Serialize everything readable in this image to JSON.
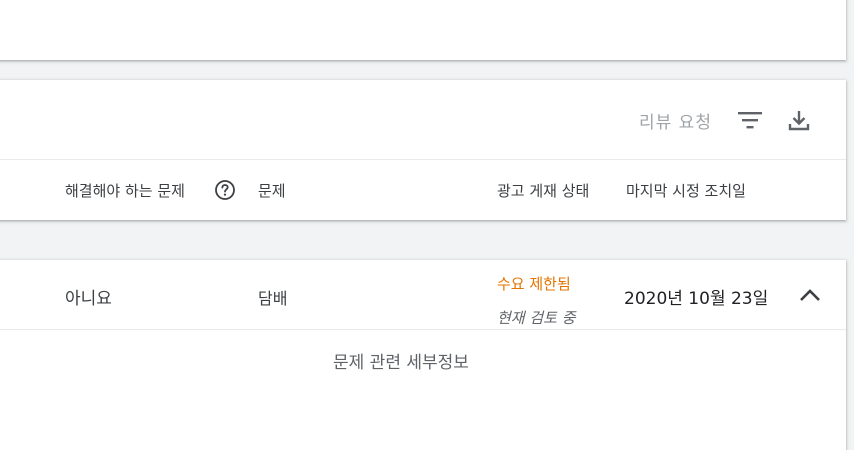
{
  "toolbar": {
    "review_label": "리뷰 요청",
    "filter_icon": "filter-icon",
    "download_icon": "download-icon"
  },
  "table": {
    "headers": {
      "issue": "해결해야 하는 문제",
      "problem": "문제",
      "ad_status": "광고 게재 상태",
      "last_action": "마지막 시정 조치일"
    },
    "help_icon": "help-circle-icon",
    "rows": [
      {
        "issue": "아니요",
        "problem": "담배",
        "status": "수요 제한됨",
        "status_sub": "현재 검토 중",
        "last_action": "2020년 10월 23일",
        "expand_icon": "chevron-up-icon"
      }
    ],
    "details_label": "문제 관련 세부정보"
  },
  "colors": {
    "status_limited": "#e37400",
    "text_primary": "#3c4043",
    "text_muted": "#a0a4a8",
    "background": "#f1f3f4"
  }
}
